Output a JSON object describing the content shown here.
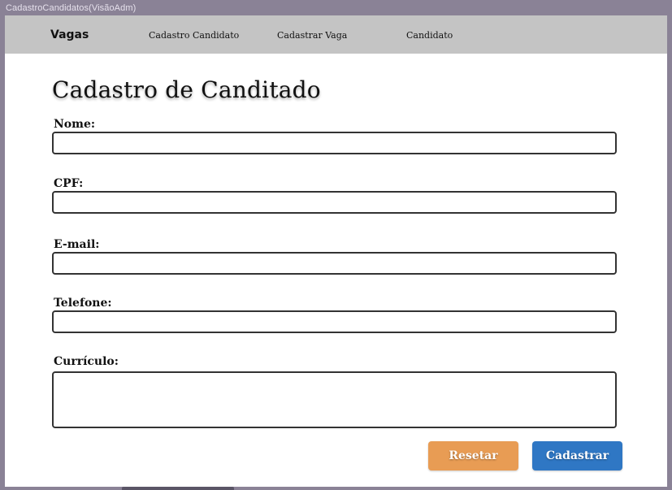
{
  "window": {
    "title": "CadastroCandidatos(VisãoAdm)"
  },
  "navbar": {
    "brand": "Vagas",
    "links": [
      "Cadastro Candidato",
      "Cadastrar Vaga",
      "Candidato"
    ]
  },
  "form": {
    "title": "Cadastro de Canditado",
    "fields": [
      {
        "label": "Nome:",
        "value": ""
      },
      {
        "label": "CPF:",
        "value": ""
      },
      {
        "label": "E-mail:",
        "value": ""
      },
      {
        "label": "Telefone:",
        "value": ""
      },
      {
        "label": "Currículo:",
        "value": ""
      }
    ],
    "buttons": {
      "reset": "Resetar",
      "submit": "Cadastrar"
    }
  },
  "colors": {
    "reset_button": "#e89c54",
    "submit_button": "#2f77c4",
    "navbar_background": "#c4c4c4",
    "window_chrome": "#8a8296"
  }
}
